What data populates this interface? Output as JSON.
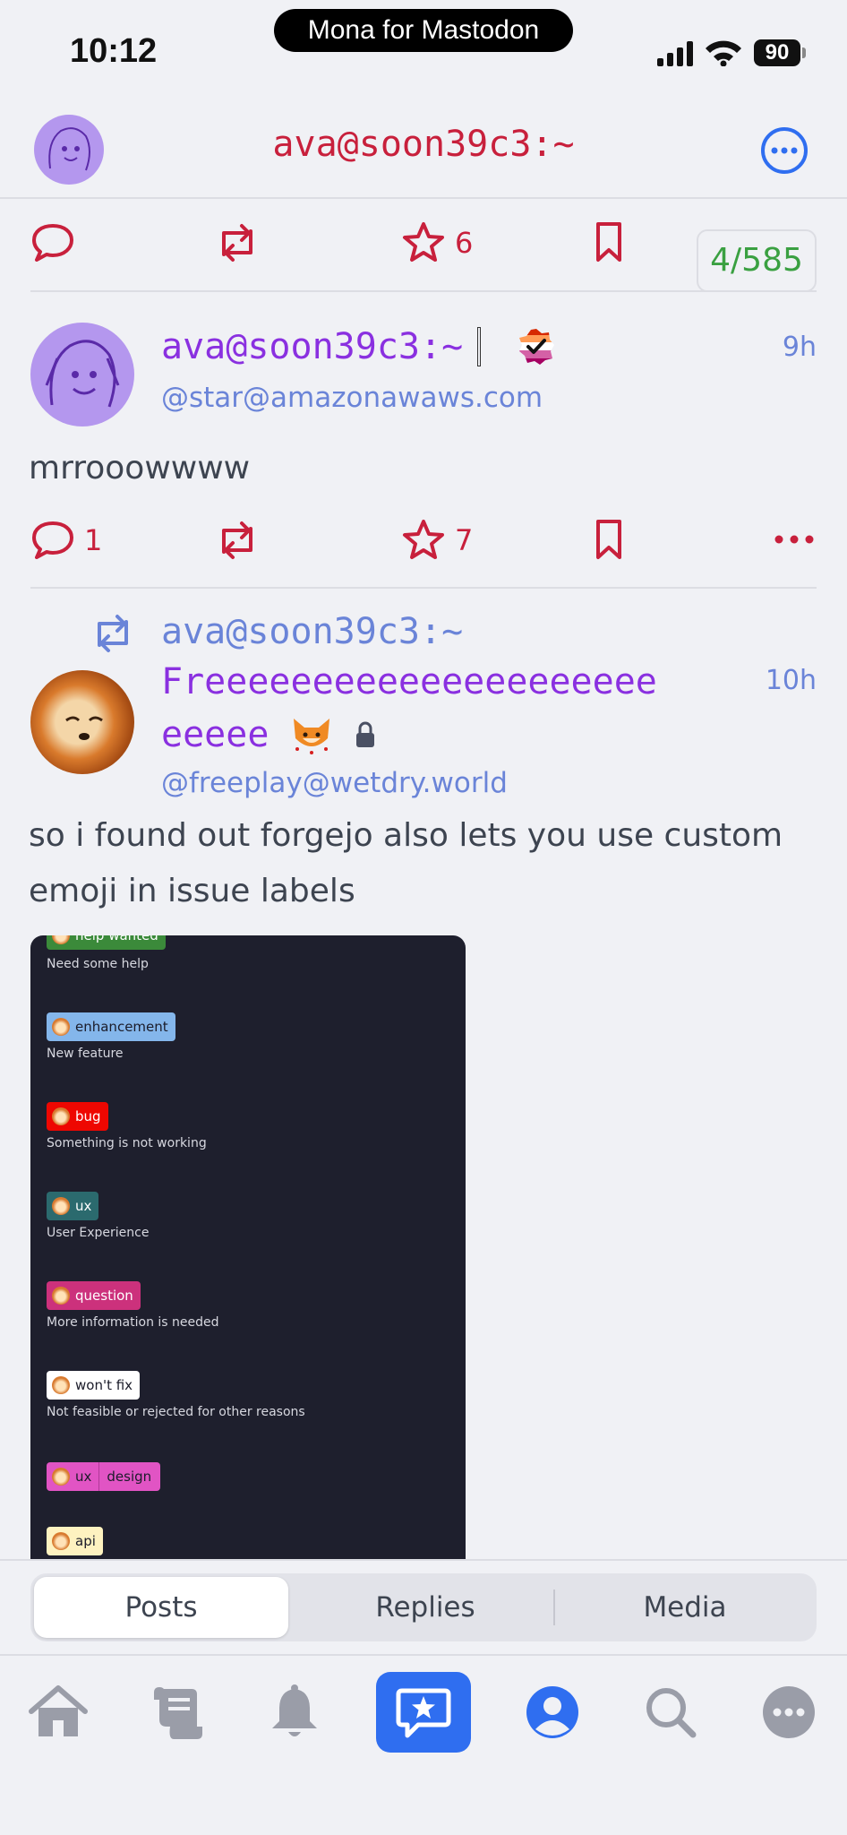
{
  "status_bar": {
    "time": "10:12",
    "app_label": "Mona for Mastodon",
    "battery": "90"
  },
  "header": {
    "title": "ava@soon39c3:~"
  },
  "top_actions": {
    "favorites": "6",
    "counter": "4/585"
  },
  "post1": {
    "display_name": "ava@soon39c3:~",
    "handle": "@star@amazonawaws.com",
    "time": "9h",
    "body": "mrrooowwww",
    "replies": "1",
    "favorites": "7"
  },
  "post2": {
    "boosted_by": "ava@soon39c3:~",
    "display_name_line1": "Freeeeeeeeeeeeeeeeeeeee",
    "display_name_line2": "eeeee",
    "handle": "@freeplay@wetdry.world",
    "time": "10h",
    "body": "so i found out forgejo also lets you use custom emoji in issue labels"
  },
  "attachment": {
    "labels": [
      {
        "name": "help wanted",
        "description": "Need some help",
        "color": "#3b8a3a",
        "text_color": "#ffffff"
      },
      {
        "name": "enhancement",
        "description": "New feature",
        "color": "#84b6eb",
        "text_color": "#1b1c2a"
      },
      {
        "name": "bug",
        "description": "Something is not working",
        "color": "#ee0701",
        "text_color": "#ffffff"
      },
      {
        "name": "ux",
        "description": "User Experience",
        "color": "#2b6a6e",
        "text_color": "#ffffff"
      },
      {
        "name": "question",
        "description": "More information is needed",
        "color": "#cc317c",
        "text_color": "#ffffff"
      },
      {
        "name": "won't fix",
        "description": "Not feasible or rejected for other reasons",
        "color": "#ffffff",
        "text_color": "#1b1c2a"
      },
      {
        "name": "ux",
        "name2": "design",
        "description": "",
        "color": "#e154c4",
        "text_color": "#1b1c2a"
      },
      {
        "name": "api",
        "description": "",
        "color": "#fef2c0",
        "text_color": "#1b1c2a"
      }
    ]
  },
  "segments": {
    "posts": "Posts",
    "replies": "Replies",
    "media": "Media"
  },
  "tabs": [
    "home-icon",
    "timeline-scroll-icon",
    "notifications-bell-icon",
    "compose-star-icon",
    "profile-icon",
    "search-icon",
    "more-icon"
  ],
  "colors": {
    "accent": "#c8203c",
    "name": "#8a30e0",
    "link": "#6a84d8",
    "tab_active": "#2f6ef0",
    "counter": "#3aa041"
  }
}
